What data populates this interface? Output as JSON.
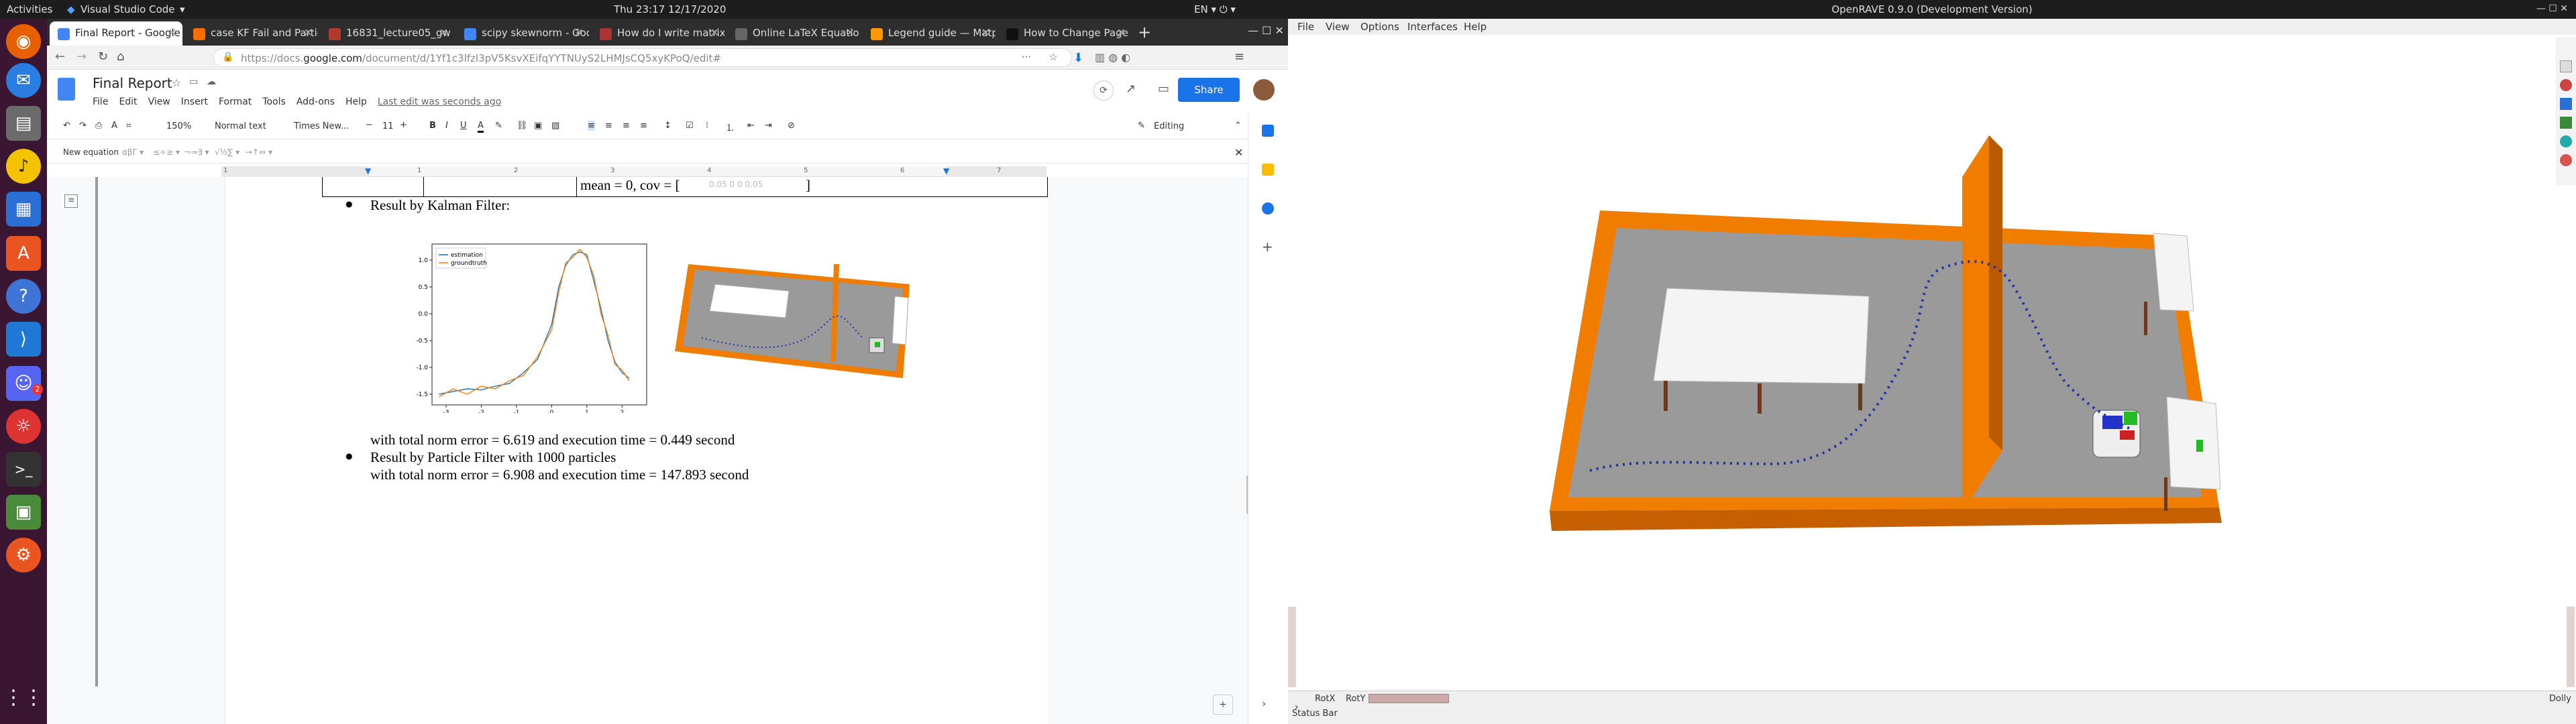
{
  "system": {
    "activities": "Activities",
    "app": "Visual Studio Code",
    "app_arrow": "▾",
    "clock": "Thu 23:17   12/17/2020",
    "tray": "EN ▾  ⏻ ▾"
  },
  "dock": {
    "badge": "2"
  },
  "browser": {
    "tabs": [
      {
        "title": "Final Report - Google D",
        "color": "#4285f4"
      },
      {
        "title": "case KF Fail and Partic",
        "color": "#ff6d00"
      },
      {
        "title": "16831_lecture05_gw",
        "color": "#b03a2e"
      },
      {
        "title": "scipy skewnorm - Goo",
        "color": "#4285f4"
      },
      {
        "title": "How do I write matrix",
        "color": "#aa3333"
      },
      {
        "title": "Online LaTeX Equatio",
        "color": "#666666"
      },
      {
        "title": "Legend guide — Matp",
        "color": "#ff9800"
      },
      {
        "title": "How to Change Page O",
        "color": "#111111"
      }
    ],
    "new_tab": "+",
    "url": "https://docs.google.com/document/d/1Yf1c3lfzl3pV5KsvXEifqYYTNUyS2LHMJsCQ5xyKPoQ/edit#",
    "url_domain_prefix": "https://docs.",
    "url_domain": "google.com",
    "url_rest": "/document/d/1Yf1c3lfzl3pV5KsvXEifqYYTNUyS2LHMJsCQ5xyKPoQ/edit#"
  },
  "docs": {
    "title": "Final Report",
    "menus": [
      "File",
      "Edit",
      "View",
      "Insert",
      "Format",
      "Tools",
      "Add-ons",
      "Help"
    ],
    "last_edit": "Last edit was seconds ago",
    "share": "Share",
    "zoom": "150%",
    "style": "Normal text",
    "font": "Times New...",
    "size": "11",
    "mode": "Editing",
    "new_equation": "New equation",
    "eq_groups": [
      "αβΓ ▾",
      "≤÷≥ ▾",
      "¬⇒∃ ▾",
      "√½∑ ▾",
      "→↑⇔ ▾"
    ],
    "ruler_marks": [
      "1",
      "1",
      "2",
      "3",
      "4",
      "5",
      "6",
      "7"
    ],
    "table_text": "mean = 0, cov = [",
    "table_text_faint": "0.05  0  0  0.05",
    "bullet1": "Result by Kalman Filter:",
    "line1": "with total norm error = 6.619 and execution time = 0.449 second",
    "bullet2": "Result by Particle Filter with 1000 particles",
    "line2": "with total norm error = 6.908 and execution time = 147.893 second"
  },
  "chart_data": {
    "type": "line",
    "title": "",
    "xlabel": "",
    "ylabel": "",
    "xlim": [
      -3.4,
      2.7
    ],
    "ylim": [
      -1.7,
      1.3
    ],
    "xticks": [
      "-3",
      "-2",
      "-1",
      "0",
      "1",
      "2"
    ],
    "yticks": [
      "1.0",
      "0.5",
      "0.0",
      "-0.5",
      "-1.0",
      "-1.5"
    ],
    "series": [
      {
        "name": "estimation",
        "color": "#1f77b4",
        "x": [
          -3.2,
          -2.8,
          -2.4,
          -2.0,
          -1.6,
          -1.2,
          -0.8,
          -0.4,
          0.0,
          0.2,
          0.4,
          0.6,
          0.8,
          1.0,
          1.2,
          1.4,
          1.6,
          1.8,
          2.0,
          2.2
        ],
        "y": [
          -1.5,
          -1.45,
          -1.4,
          -1.42,
          -1.35,
          -1.3,
          -1.1,
          -0.85,
          -0.2,
          0.5,
          0.9,
          1.1,
          1.15,
          1.1,
          0.6,
          0.1,
          -0.5,
          -0.9,
          -1.1,
          -1.2
        ]
      },
      {
        "name": "groundtruth",
        "color": "#ff7f0e",
        "x": [
          -3.2,
          -2.8,
          -2.4,
          -2.0,
          -1.6,
          -1.2,
          -0.8,
          -0.4,
          0.0,
          0.2,
          0.4,
          0.6,
          0.8,
          1.0,
          1.2,
          1.4,
          1.6,
          1.8,
          2.0,
          2.2
        ],
        "y": [
          -1.55,
          -1.4,
          -1.5,
          -1.35,
          -1.4,
          -1.25,
          -1.15,
          -0.8,
          -0.3,
          0.4,
          0.95,
          1.05,
          1.2,
          1.05,
          0.7,
          0.0,
          -0.4,
          -0.95,
          -1.05,
          -1.25
        ]
      }
    ]
  },
  "openrave": {
    "title": "OpenRAVE 0.9.0 (Development Version)",
    "menus": [
      "File",
      "View",
      "Options",
      "Interfaces",
      "Help"
    ],
    "rotx": "RotX",
    "roty": "RotY",
    "dolly": "Dolly",
    "status": "Status Bar"
  },
  "colors": {
    "accent": "#1a73e8",
    "orange": "#f07d00",
    "dock": "#3b1632"
  }
}
